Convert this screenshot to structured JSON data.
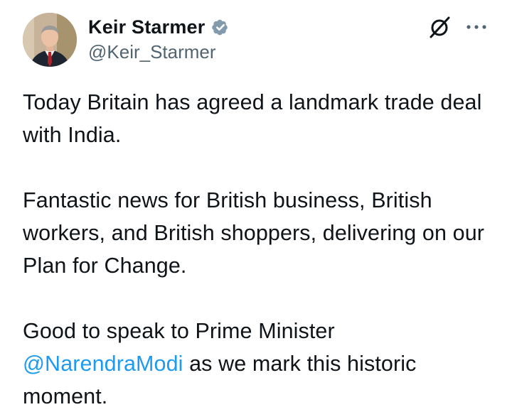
{
  "author": {
    "display_name": "Keir Starmer",
    "handle": "@Keir_Starmer",
    "verified": true
  },
  "icons": {
    "verified": "verified-badge-icon",
    "grok": "grok-icon",
    "more": "more-options-icon"
  },
  "colors": {
    "text": "#0f1419",
    "secondary_text": "#536471",
    "link": "#1d9bf0",
    "verified_badge": "#829aab"
  },
  "tweet": {
    "paragraph1": "Today Britain has agreed a landmark trade deal with India.",
    "paragraph2": "Fantastic news for British business, British workers, and British shoppers, delivering on our Plan for Change.",
    "paragraph3_prefix": "Good to speak to Prime Minister",
    "mention": "@NarendraModi",
    "paragraph3_suffix": "as we mark this historic moment."
  }
}
